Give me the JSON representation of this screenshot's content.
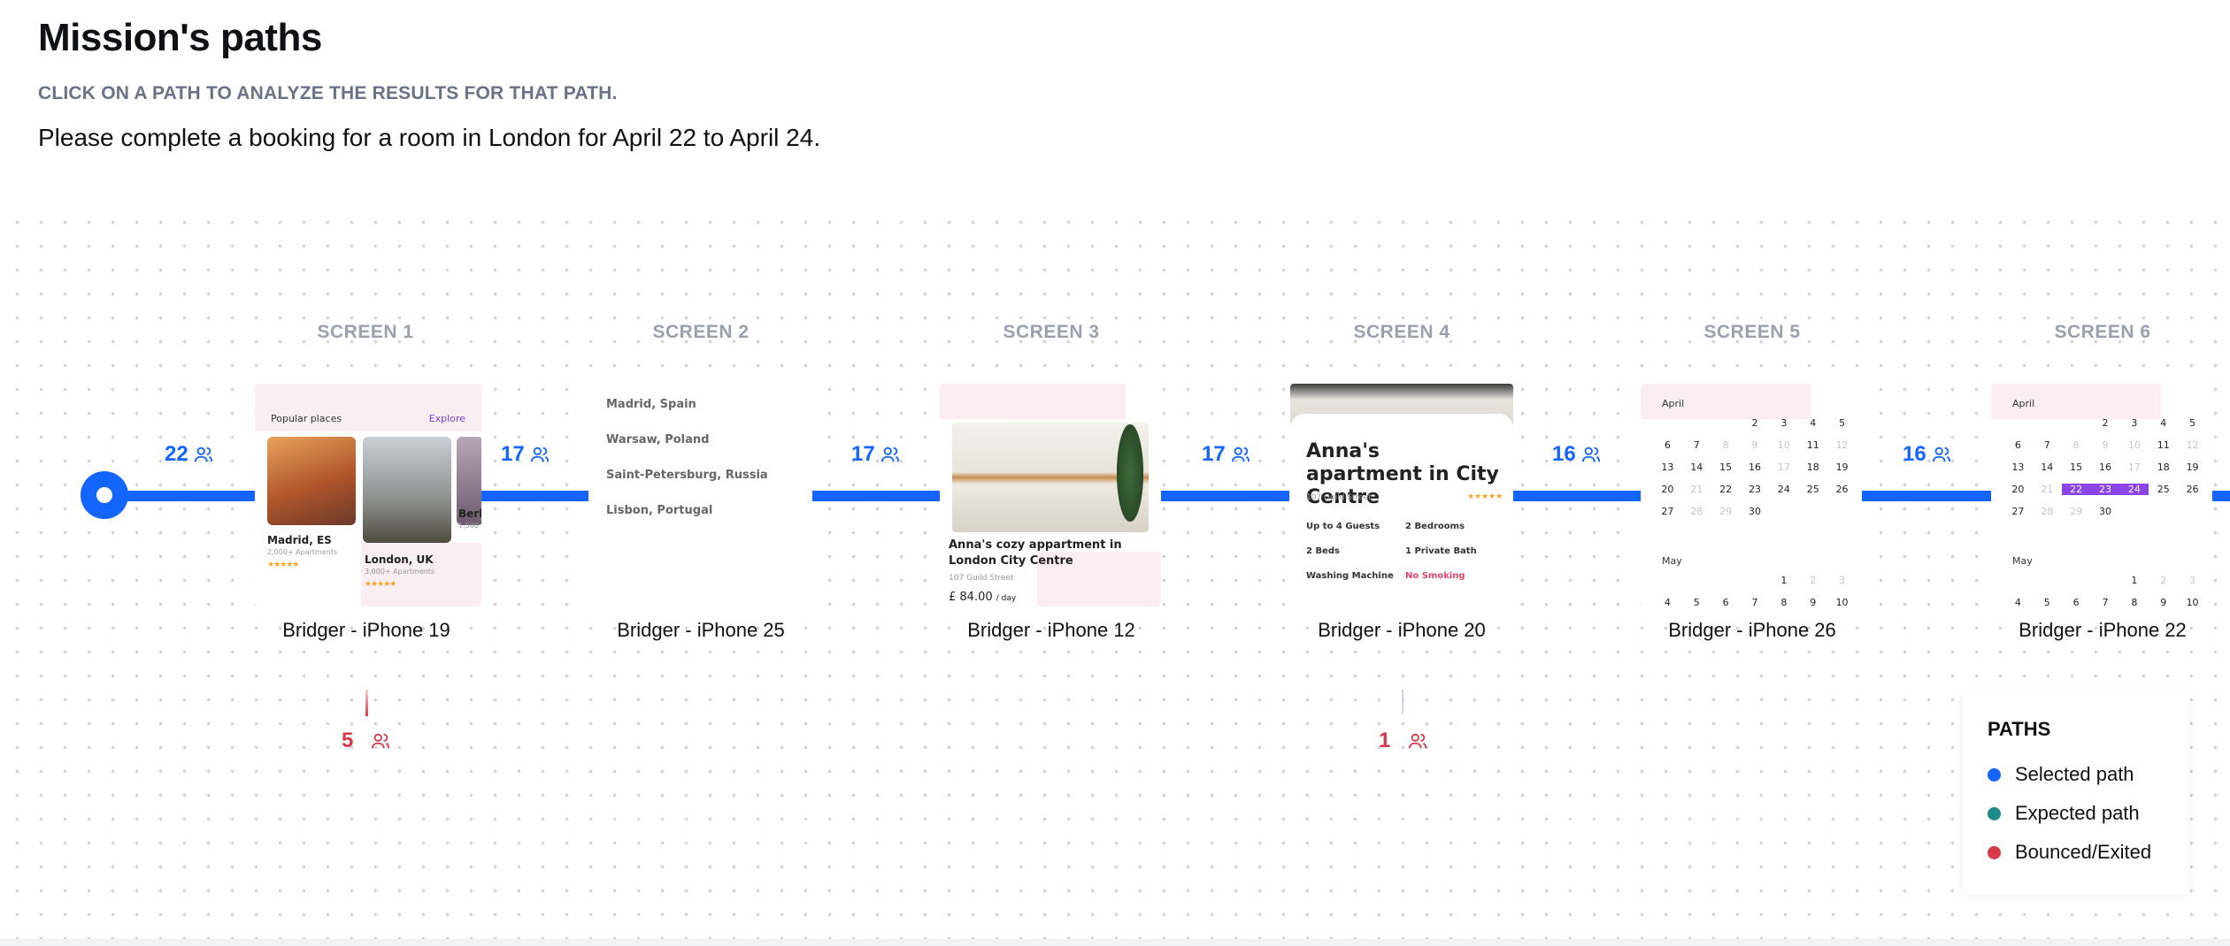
{
  "header": {
    "title": "Mission's paths",
    "subtitle": "CLICK ON A PATH TO ANALYZE THE RESULTS FOR THAT PATH.",
    "task": "Please complete a booking for a room in London for April 22 to April 24."
  },
  "screens": [
    {
      "label": "SCREEN 1",
      "device": "Bridger - iPhone 19"
    },
    {
      "label": "SCREEN 2",
      "device": "Bridger - iPhone 25"
    },
    {
      "label": "SCREEN 3",
      "device": "Bridger - iPhone 12"
    },
    {
      "label": "SCREEN 4",
      "device": "Bridger - iPhone 20"
    },
    {
      "label": "SCREEN 5",
      "device": "Bridger - iPhone 26"
    },
    {
      "label": "SCREEN 6",
      "device": "Bridger - iPhone 22"
    }
  ],
  "path_counts": [
    "22",
    "17",
    "17",
    "17",
    "16",
    "16"
  ],
  "exit_counts": {
    "screen1": "5",
    "screen4": "1"
  },
  "legend": {
    "title": "PATHS",
    "items": [
      {
        "label": "Selected path",
        "color": "#1464ff"
      },
      {
        "label": "Expected path",
        "color": "#1f8a8a"
      },
      {
        "label": "Bounced/Exited",
        "color": "#d73a49"
      }
    ]
  },
  "thumb1": {
    "header": "Popular places",
    "explore": "Explore",
    "card1_title": "Madrid, ES",
    "card1_sub": "2,000+ Apartments",
    "card1_rating": "★★★★★",
    "card2_title": "London, UK",
    "card2_sub": "3,000+ Apartments",
    "card2_rating": "★★★★★",
    "card3_title": "Berl",
    "card3_sub": "1,500"
  },
  "thumb2": {
    "items": [
      "Madrid, Spain",
      "Warsaw, Poland",
      "Saint-Petersburg, Russia",
      "Lisbon, Portugal"
    ]
  },
  "thumb3": {
    "title": "Anna's cozy appartment in London City Centre",
    "address": "107  Guild Street",
    "price": "£ 84.00",
    "per": "/ day"
  },
  "thumb4": {
    "title": "Anna's apartment in City Centre",
    "address": "107  Guild Street",
    "rating": "★★★★★",
    "features": [
      "Up to 4 Guests",
      "2 Bedrooms",
      "2 Beds",
      "1 Private Bath",
      "Washing Machine",
      "No Smoking"
    ]
  },
  "calendar": {
    "month1": "April",
    "month2": "May",
    "april": [
      "",
      "",
      "",
      "2",
      "3",
      "4",
      "5",
      "6",
      "7",
      "8",
      "9",
      "10",
      "11",
      "12",
      "13",
      "14",
      "15",
      "16",
      "17",
      "18",
      "19",
      "20",
      "21",
      "22",
      "23",
      "24",
      "25",
      "26",
      "27",
      "28",
      "29",
      "30",
      "",
      "",
      ""
    ],
    "may": [
      "",
      "",
      "",
      "",
      "1",
      "2",
      "3",
      "4",
      "5",
      "6",
      "7",
      "8",
      "9",
      "10"
    ],
    "selected_range": [
      "22",
      "23",
      "24"
    ]
  }
}
